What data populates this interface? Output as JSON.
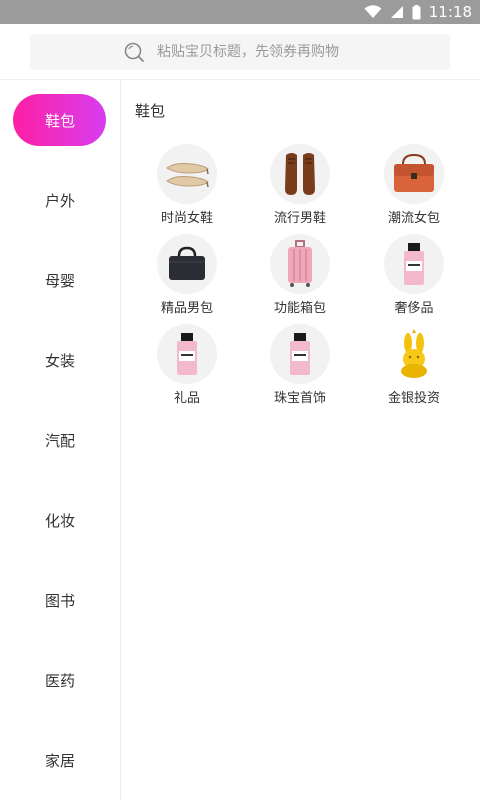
{
  "status_bar": {
    "time": "11:18",
    "icons": [
      "wifi-icon",
      "signal-icon",
      "battery-icon"
    ]
  },
  "search": {
    "placeholder": "粘贴宝贝标题，先领券再购物",
    "icon": "search-icon"
  },
  "sidebar": {
    "accent_gradient": [
      "#ff1fa3",
      "#d63ef0"
    ],
    "items": [
      {
        "label": "鞋包",
        "active": true
      },
      {
        "label": "户外",
        "active": false
      },
      {
        "label": "母婴",
        "active": false
      },
      {
        "label": "女装",
        "active": false
      },
      {
        "label": "汽配",
        "active": false
      },
      {
        "label": "化妆",
        "active": false
      },
      {
        "label": "图书",
        "active": false
      },
      {
        "label": "医药",
        "active": false
      },
      {
        "label": "家居",
        "active": false
      }
    ]
  },
  "main": {
    "section_title": "鞋包",
    "items": [
      {
        "name": "时尚女鞋",
        "icon": "heels-icon"
      },
      {
        "name": "流行男鞋",
        "icon": "mens-shoes-icon"
      },
      {
        "name": "潮流女包",
        "icon": "handbag-icon"
      },
      {
        "name": "精品男包",
        "icon": "briefcase-icon"
      },
      {
        "name": "功能箱包",
        "icon": "suitcase-icon"
      },
      {
        "name": "奢侈品",
        "icon": "perfume-icon"
      },
      {
        "name": "礼品",
        "icon": "perfume-icon"
      },
      {
        "name": "珠宝首饰",
        "icon": "perfume-icon"
      },
      {
        "name": "金银投资",
        "icon": "gold-rabbit-icon"
      }
    ]
  }
}
